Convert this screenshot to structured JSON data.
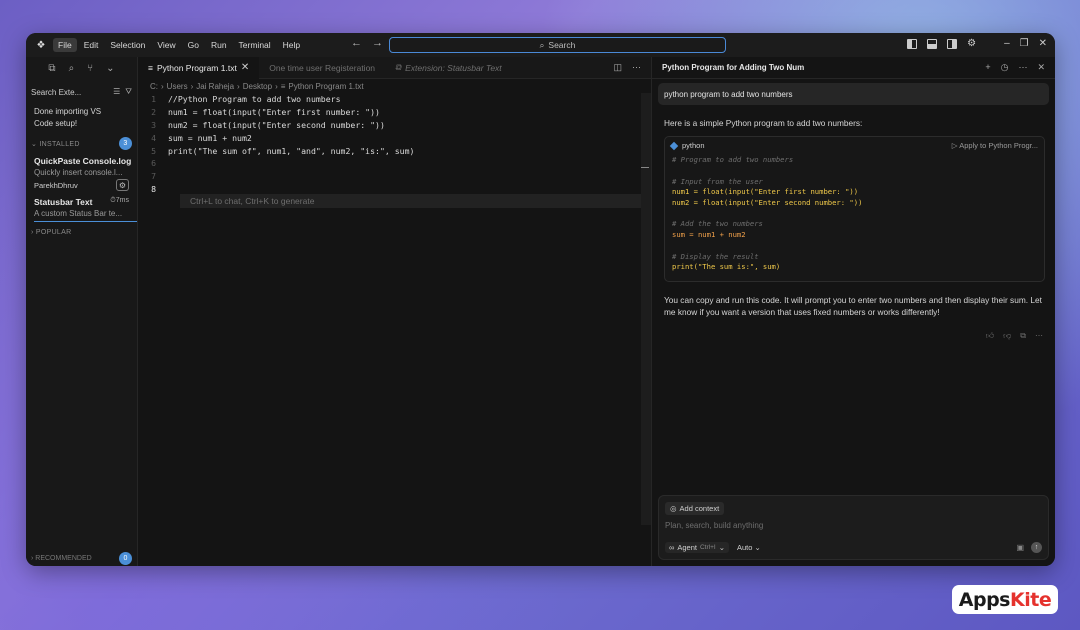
{
  "menu": [
    "File",
    "Edit",
    "Selection",
    "View",
    "Go",
    "Run",
    "Terminal",
    "Help"
  ],
  "search": {
    "label": "Search"
  },
  "sidebar": {
    "search_placeholder": "Search Exte...",
    "message_line1": "Done importing VS",
    "message_line2": "Code setup!",
    "installed_label": "INSTALLED",
    "installed_count": "3",
    "extensions": [
      {
        "name": "QuickPaste Console.log",
        "desc": "Quickly insert console.l...",
        "publisher": "ParekhDhruv"
      },
      {
        "name": "Statusbar Text",
        "time": "7ms",
        "desc": "A custom Status Bar te..."
      }
    ],
    "popular_label": "POPULAR",
    "recommended_label": "RECOMMENDED",
    "recommended_count": "0"
  },
  "editor": {
    "tabs": [
      {
        "label": "Python Program 1.txt",
        "state": "active"
      },
      {
        "label": "One time user Registeration",
        "state": "inactive"
      },
      {
        "label": "Extension: Statusbar Text",
        "state": "preview"
      }
    ],
    "breadcrumb": [
      "C:",
      "Users",
      "Jai Raheja",
      "Desktop",
      "Python Program 1.txt"
    ],
    "lines": [
      {
        "n": "1",
        "text": "//Python Program to add two numbers"
      },
      {
        "n": "2",
        "text": "num1 = float(input(\"Enter first number: \"))"
      },
      {
        "n": "3",
        "text": "num2 = float(input(\"Enter second number: \"))"
      },
      {
        "n": "4",
        "text": "sum = num1 + num2"
      },
      {
        "n": "5",
        "text": "print(\"The sum of\", num1, \"and\", num2, \"is:\", sum)"
      },
      {
        "n": "6",
        "text": ""
      },
      {
        "n": "7",
        "text": ""
      },
      {
        "n": "8",
        "text": ""
      }
    ],
    "current_line": "8",
    "inline_hint": "Ctrl+L to chat, Ctrl+K to generate"
  },
  "chat": {
    "title": "Python Program for Adding Two Num",
    "user_message": "python program to add two numbers",
    "intro": "Here is a simple Python program to add two numbers:",
    "code_lang": "python",
    "apply_label": "Apply to Python Progr...",
    "code_lines": [
      "# Program to add two numbers",
      "",
      "# Input from the user",
      "num1 = float(input(\"Enter first number: \"))",
      "num2 = float(input(\"Enter second number: \"))",
      "",
      "# Add the two numbers",
      "sum = num1 + num2",
      "",
      "# Display the result",
      "print(\"The sum is:\", sum)"
    ],
    "outro": "You can copy and run this code. It will prompt you to enter two numbers and then display their sum. Let me know if you want a version that uses fixed numbers or works differently!",
    "composer": {
      "add_context": "Add context",
      "placeholder": "Plan, search, build anything",
      "mode": "Agent",
      "mode_kbd": "Ctrl+I",
      "model": "Auto"
    }
  },
  "brand": {
    "part1": "Apps",
    "part2": "Kite"
  },
  "colors": {
    "accent": "#4b8fd7",
    "code_yellow": "#f0c94a",
    "code_orange": "#f0a04a"
  }
}
